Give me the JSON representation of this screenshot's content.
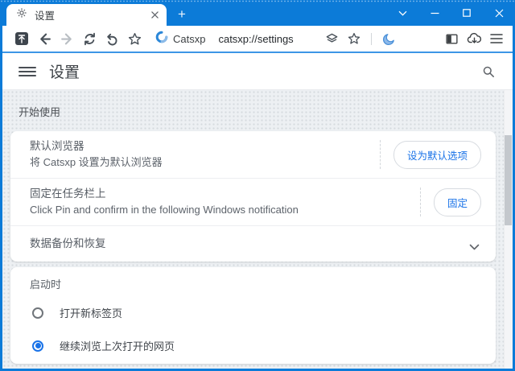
{
  "window": {
    "tab_title": "设置",
    "new_tab_button": "+"
  },
  "toolbar": {
    "site_label": "Catsxp",
    "url": "catsxp://settings"
  },
  "page_header": {
    "title": "设置"
  },
  "content": {
    "section_label": "开始使用",
    "setup_card": {
      "rows": [
        {
          "title": "默认浏览器",
          "subtitle": "将 Catsxp 设置为默认浏览器",
          "button_label": "设为默认选项"
        },
        {
          "title": "固定在任务栏上",
          "subtitle": "Click Pin and confirm in the following Windows notification",
          "button_label": "固定"
        },
        {
          "title": "数据备份和恢复"
        }
      ]
    },
    "startup_card": {
      "section_label": "启动时",
      "options": [
        {
          "label": "打开新标签页",
          "selected": false
        },
        {
          "label": "继续浏览上次打开的网页",
          "selected": true
        }
      ]
    }
  },
  "colors": {
    "frame_blue": "#0c7bd8",
    "accent_line_blue": "#3d96e6",
    "link_blue": "#1a73e8",
    "moon_blue": "#63a1e4"
  },
  "icons": {
    "tab": "gear-icon",
    "toolbar": [
      "boss-key-icon",
      "back-icon",
      "forward-icon",
      "refresh-icon",
      "undo-icon",
      "star-outline-icon",
      "catsxp-logo",
      "layers-icon",
      "bookmark-star-icon",
      "moon-icon",
      "sidebar-icon",
      "cloud-download-icon",
      "hamburger-icon"
    ],
    "window_controls": [
      "chevron-down",
      "minimize",
      "maximize",
      "close"
    ],
    "page": [
      "menu-icon",
      "search-icon",
      "chevron-down-icon",
      "radio-unselected",
      "radio-selected"
    ]
  }
}
